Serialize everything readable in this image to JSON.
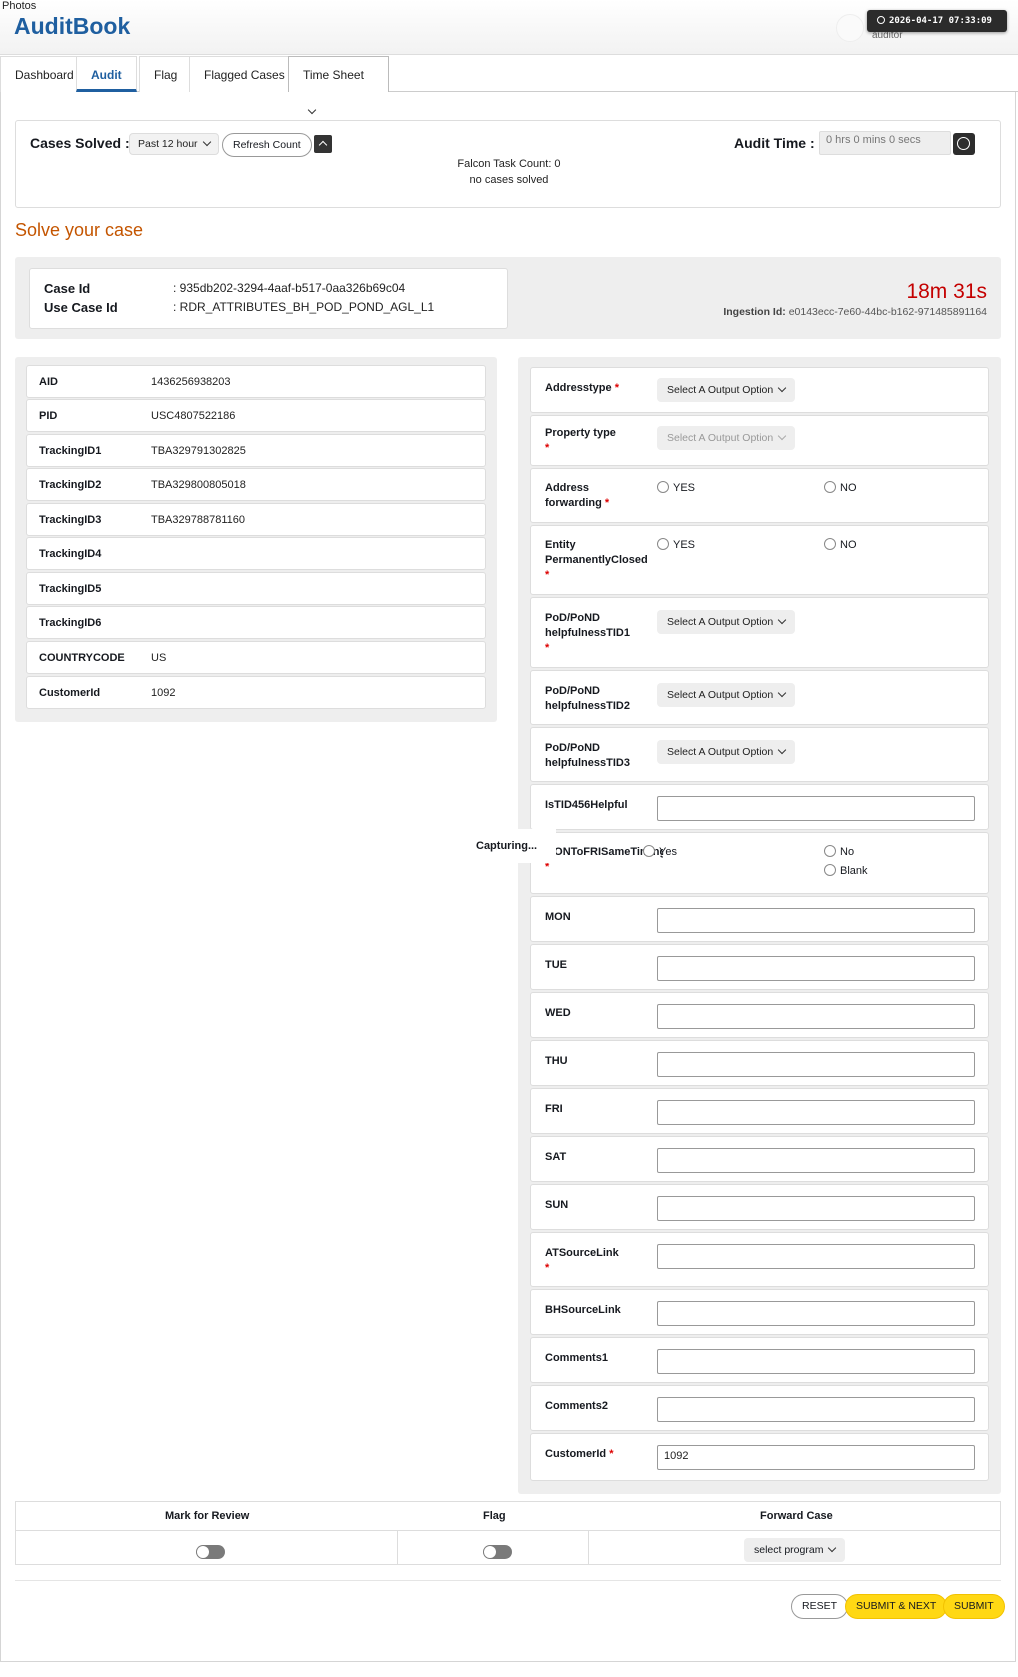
{
  "header": {
    "photos_text": "Photos",
    "brand": "AuditBook",
    "user_role": "auditor",
    "clock": "2026-04-17 07:33:09"
  },
  "tabs": [
    {
      "label": "Dashboard",
      "active": false
    },
    {
      "label": "Audit",
      "active": true
    },
    {
      "label": "Flag",
      "active": false
    },
    {
      "label": "Flagged Cases",
      "active": false
    },
    {
      "label": "Time Sheet",
      "active": false
    }
  ],
  "stats": {
    "cases_solved_label": "Cases Solved :",
    "period_select": "Past 12 hour",
    "refresh_label": "Refresh Count",
    "audit_time_label": "Audit Time :",
    "audit_time_value": "0 hrs 0 mins 0 secs",
    "falcon_count": "Falcon Task Count: 0",
    "no_cases": "no cases solved"
  },
  "solve_title": "Solve your case",
  "case": {
    "case_id_label": "Case Id",
    "case_id": ": 935db202-3294-4aaf-b517-0aa326b69c04",
    "use_case_label": "Use Case Id",
    "use_case": ": RDR_ATTRIBUTES_BH_POD_POND_AGL_L1",
    "timer": "18m 31s",
    "ingestion_label": "Ingestion Id:",
    "ingestion_id": "e0143ecc-7e60-44bc-b162-971485891164"
  },
  "attributes": [
    {
      "key": "AID",
      "value": "1436256938203"
    },
    {
      "key": "PID",
      "value": "USC4807522186"
    },
    {
      "key": "TrackingID1",
      "value": "TBA329791302825"
    },
    {
      "key": "TrackingID2",
      "value": "TBA329800805018"
    },
    {
      "key": "TrackingID3",
      "value": "TBA329788781160"
    },
    {
      "key": "TrackingID4",
      "value": ""
    },
    {
      "key": "TrackingID5",
      "value": ""
    },
    {
      "key": "TrackingID6",
      "value": ""
    },
    {
      "key": "COUNTRYCODE",
      "value": "US"
    },
    {
      "key": "CustomerId",
      "value": "1092"
    }
  ],
  "form": {
    "select_placeholder": "Select A Output Option",
    "addresstype": "Addresstype",
    "property_type": "Property type",
    "address_forwarding": "Address forwarding",
    "entity_closed": "Entity PermanentlyClosed",
    "pod1": "PoD/PoND helpfulnessTID1",
    "pod2": "PoD/PoND helpfulnessTID2",
    "pod3": "PoD/PoND helpfulnessTID3",
    "istid456": "IsTID456Helpful",
    "montofri": "MONToFRISameTiming",
    "yes_upper": "YES",
    "no_upper": "NO",
    "yes": "Yes",
    "no": "No",
    "blank": "Blank",
    "days": [
      "MON",
      "TUE",
      "WED",
      "THU",
      "FRI",
      "SAT",
      "SUN"
    ],
    "at_source": "ATSourceLink",
    "bh_source": "BHSourceLink",
    "comments1": "Comments1",
    "comments2": "Comments2",
    "customer_id_label": "CustomerId",
    "customer_id_value": "1092",
    "required_mark": "*"
  },
  "capturing": "Capturing...",
  "actions": {
    "mark_review": "Mark for Review",
    "flag": "Flag",
    "forward": "Forward Case",
    "program_select": "select program",
    "reset": "RESET",
    "submit_next": "SUBMIT & NEXT",
    "submit": "SUBMIT"
  }
}
